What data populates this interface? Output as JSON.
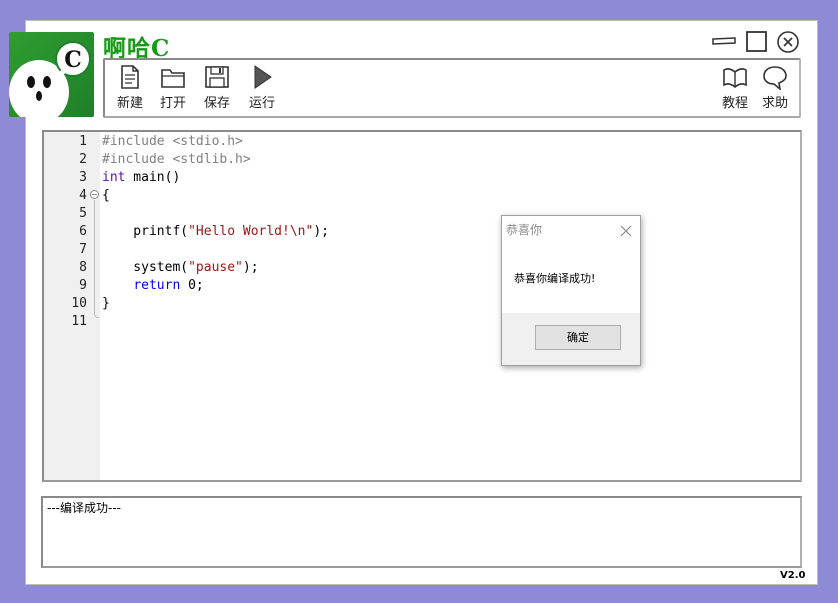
{
  "app": {
    "title": "啊哈C",
    "logo_letter": "C",
    "version": "V2.0"
  },
  "window_controls": [
    "minimize-icon",
    "maximize-icon",
    "close-icon"
  ],
  "toolbar": {
    "new_label": "新建",
    "open_label": "打开",
    "save_label": "保存",
    "run_label": "运行",
    "tutorial_label": "教程",
    "help_label": "求助"
  },
  "editor": {
    "line_numbers": [
      "1",
      "2",
      "3",
      "4",
      "5",
      "6",
      "7",
      "8",
      "9",
      "10",
      "11"
    ]
  },
  "code": {
    "l1": "#include <stdio.h>",
    "l2": "#include <stdlib.h>",
    "l3_kw": "int",
    "l3_rest": " main()",
    "l4": "{",
    "l6_a": "    printf(",
    "l6_str": "\"Hello World!\\n\"",
    "l6_b": ");",
    "l8_a": "    system(",
    "l8_str": "\"pause\"",
    "l8_b": ");",
    "l9_a": "    ",
    "l9_kw": "return",
    "l9_b": " 0;",
    "l10": "}"
  },
  "output": {
    "text": "---编译成功---"
  },
  "dialog": {
    "title": "恭喜你",
    "message": "恭喜你编译成功!",
    "ok_label": "确定"
  }
}
